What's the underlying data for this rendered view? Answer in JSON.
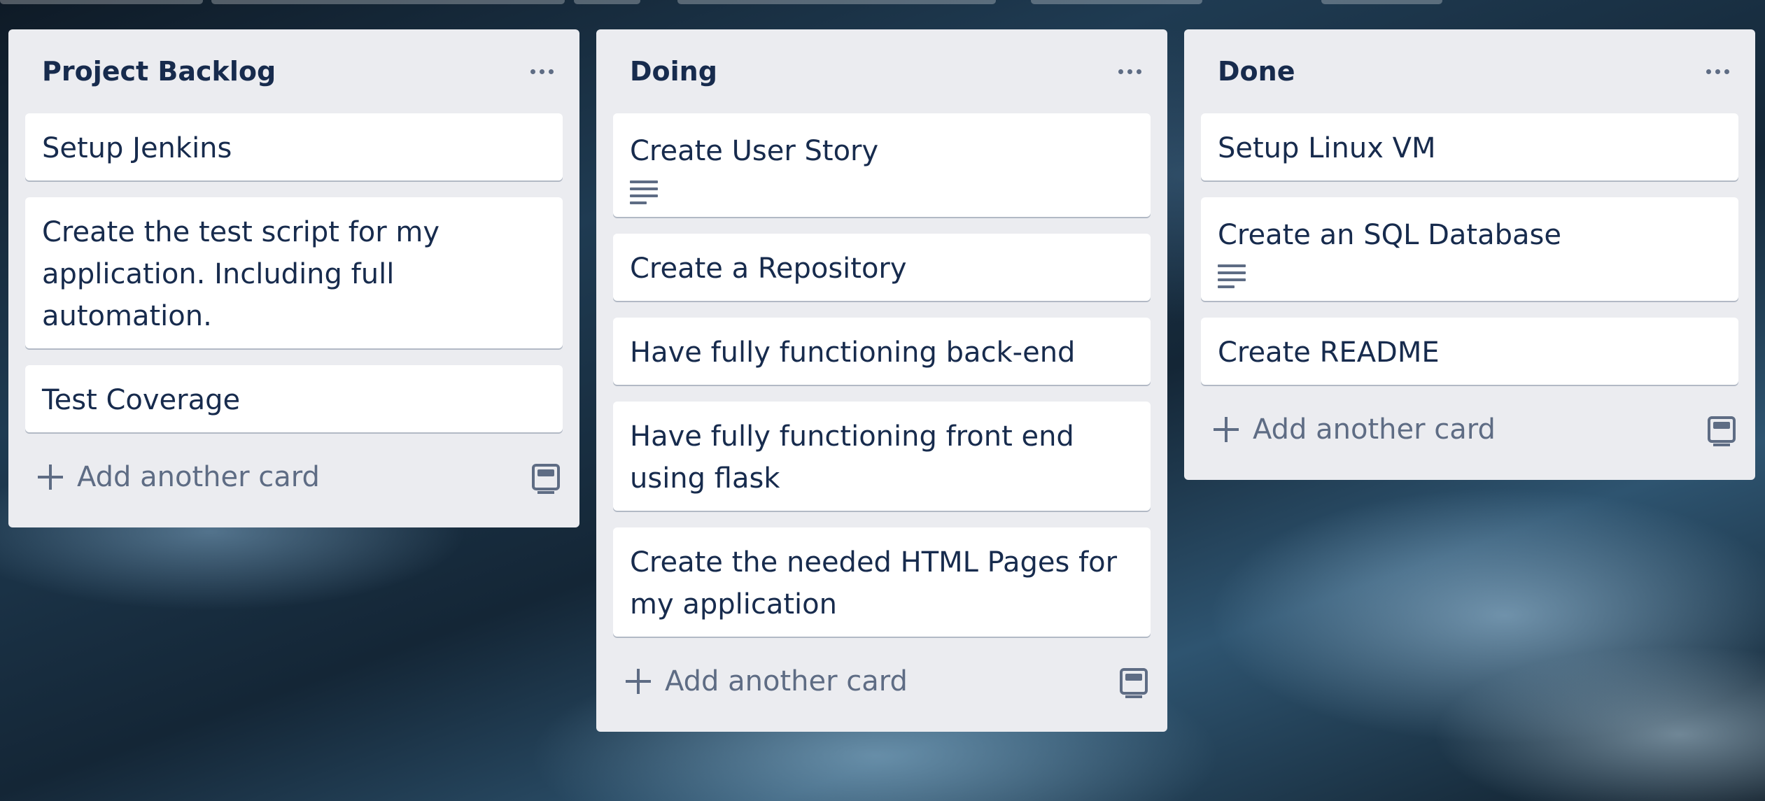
{
  "lists": [
    {
      "title": "Project Backlog",
      "cards": [
        {
          "text": "Setup Jenkins",
          "has_description": false
        },
        {
          "text": "Create the test script for my application. Including full automation.",
          "has_description": false
        },
        {
          "text": "Test Coverage",
          "has_description": false
        }
      ],
      "add_label": "Add another card"
    },
    {
      "title": "Doing",
      "cards": [
        {
          "text": "Create User Story",
          "has_description": true
        },
        {
          "text": "Create a Repository",
          "has_description": false
        },
        {
          "text": "Have fully functioning back-end",
          "has_description": false
        },
        {
          "text": "Have fully functioning front end using flask",
          "has_description": false
        },
        {
          "text": "Create the needed HTML Pages for my application",
          "has_description": false
        }
      ],
      "add_label": "Add another card"
    },
    {
      "title": "Done",
      "cards": [
        {
          "text": "Setup Linux VM",
          "has_description": false
        },
        {
          "text": "Create an SQL Database",
          "has_description": true
        },
        {
          "text": "Create README",
          "has_description": false
        }
      ],
      "add_label": "Add another card"
    }
  ],
  "icons": {
    "list_menu": "ellipsis-icon",
    "card_description": "description-icon",
    "add_card": "plus-icon",
    "create_from_template": "card-template-icon"
  },
  "colors": {
    "list_background": "#ebecf0",
    "card_background": "#ffffff",
    "title_text": "#172b4d",
    "muted_text": "#5e6c84"
  }
}
